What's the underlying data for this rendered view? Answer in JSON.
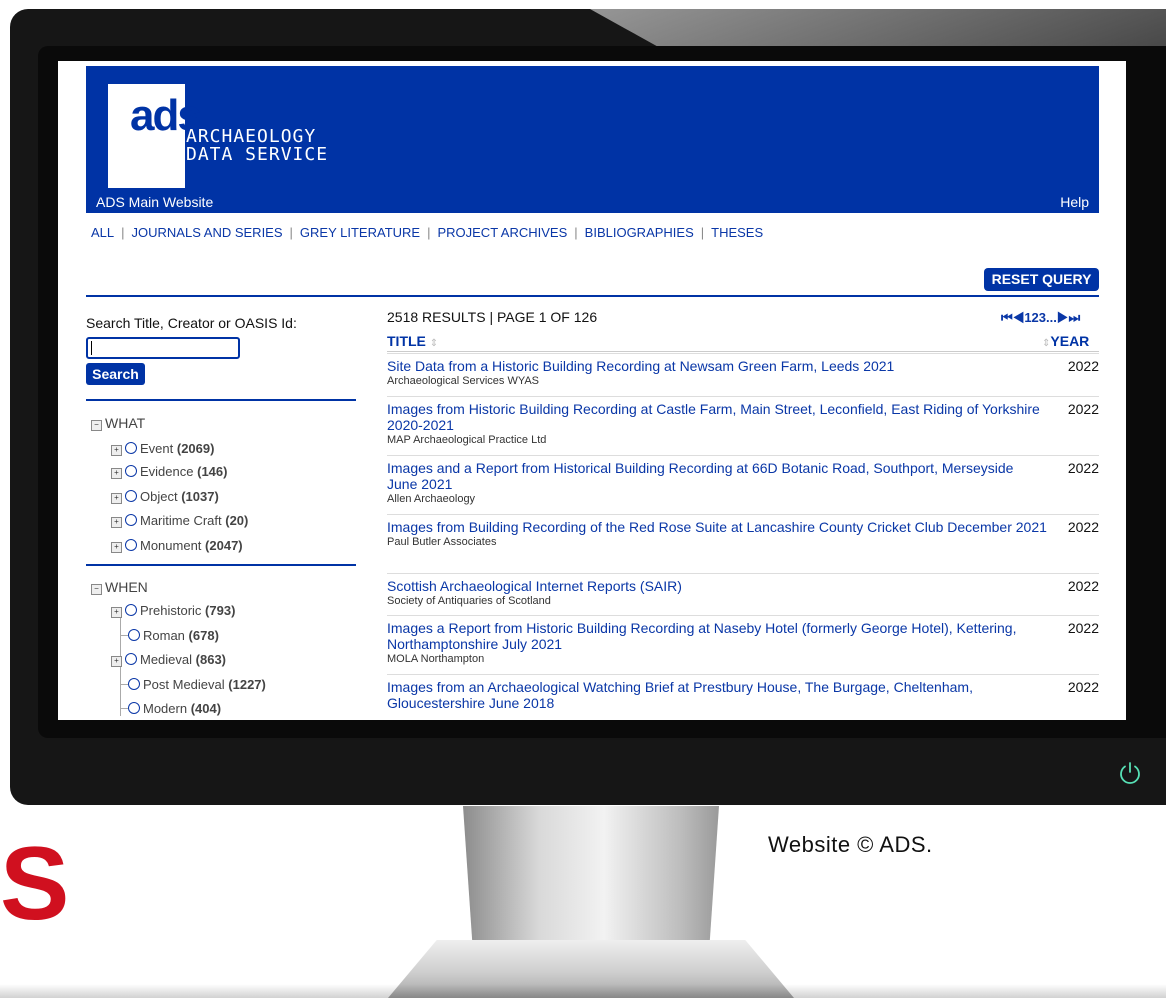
{
  "site": {
    "logo_mark": "ads",
    "logo_line1": "ARCHAEOLOGY",
    "logo_line2": "DATA SERVICE",
    "nav_main": "ADS Main Website",
    "nav_help": "Help"
  },
  "categories": [
    "ALL",
    "JOURNALS AND SERIES",
    "GREY LITERATURE",
    "PROJECT ARCHIVES",
    "BIBLIOGRAPHIES",
    "THESES"
  ],
  "reset_label": "RESET QUERY",
  "search": {
    "label": "Search Title, Creator or OASIS Id:",
    "value": "",
    "button": "Search"
  },
  "facets": {
    "what": {
      "label": "WHAT",
      "items": [
        {
          "name": "Event",
          "count": "(2069)"
        },
        {
          "name": "Evidence",
          "count": "(146)"
        },
        {
          "name": "Object",
          "count": "(1037)"
        },
        {
          "name": "Maritime Craft",
          "count": "(20)"
        },
        {
          "name": "Monument",
          "count": "(2047)"
        }
      ]
    },
    "when": {
      "label": "WHEN",
      "items": [
        {
          "name": "Prehistoric",
          "count": "(793)"
        },
        {
          "name": "Roman",
          "count": "(678)"
        },
        {
          "name": "Medieval",
          "count": "(863)"
        },
        {
          "name": "Post Medieval",
          "count": "(1227)"
        },
        {
          "name": "Modern",
          "count": "(404)"
        }
      ]
    }
  },
  "results": {
    "summary": "2518 RESULTS | PAGE 1 OF 126",
    "pager": "123...",
    "col_title": "TITLE",
    "col_year": "YEAR",
    "rows": [
      {
        "title": "Site Data from a Historic Building Recording at Newsam Green Farm, Leeds 2021",
        "creator": "Archaeological Services WYAS",
        "year": "2022"
      },
      {
        "title": "Images from Historic Building Recording at Castle Farm, Main Street, Leconfield, East Riding of Yorkshire 2020-2021",
        "creator": "MAP Archaeological Practice Ltd",
        "year": "2022"
      },
      {
        "title": "Images and a Report from Historical Building Recording at 66D Botanic Road, Southport, Merseyside June 2021",
        "creator": "Allen Archaeology",
        "year": "2022"
      },
      {
        "title": "Images from Building Recording of the Red Rose Suite at Lancashire County Cricket Club December 2021",
        "creator": "Paul Butler Associates",
        "year": "2022"
      },
      {
        "title": "Scottish Archaeological Internet Reports (SAIR)",
        "creator": "Society of Antiquaries of Scotland",
        "year": "2022"
      },
      {
        "title": "Images a Report from Historic Building Recording at Naseby Hotel (formerly George Hotel), Kettering, Northamptonshire July 2021",
        "creator": "MOLA Northampton",
        "year": "2022"
      },
      {
        "title": "Images from an Archaeological Watching Brief at Prestbury House, The Burgage, Cheltenham, Gloucestershire June 2018",
        "creator": "",
        "year": "2022"
      }
    ]
  },
  "caption": "Website © ADS.",
  "brand_letter": "S",
  "colors": {
    "ads_blue": "#0033a5",
    "link_blue": "#0a37a7",
    "brand_red": "#d0101f",
    "power_green": "#57e0b5"
  }
}
